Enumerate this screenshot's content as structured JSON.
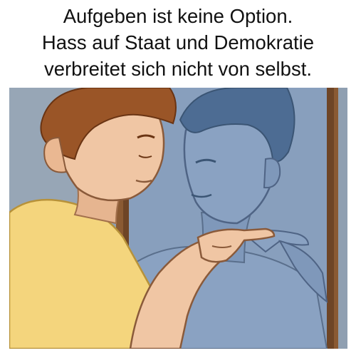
{
  "caption": {
    "lines": [
      "Aufgeben ist keine Option.",
      "Hass auf Staat und Demokratie",
      "verbreitet sich nicht von selbst."
    ]
  },
  "illustration": {
    "description_icon": "man-pointing-at-mirror-reflection-illustration",
    "colors": {
      "wall": "#8f9fb1",
      "mirror_frame": "#8a5a33",
      "mirror_glass": "#7d95b6",
      "reflection_skin": "#8aa2c2",
      "reflection_hair": "#4d6c93",
      "man_skin": "#f0c6a4",
      "man_hair": "#9a5527",
      "shirt": "#f4d57d"
    }
  }
}
